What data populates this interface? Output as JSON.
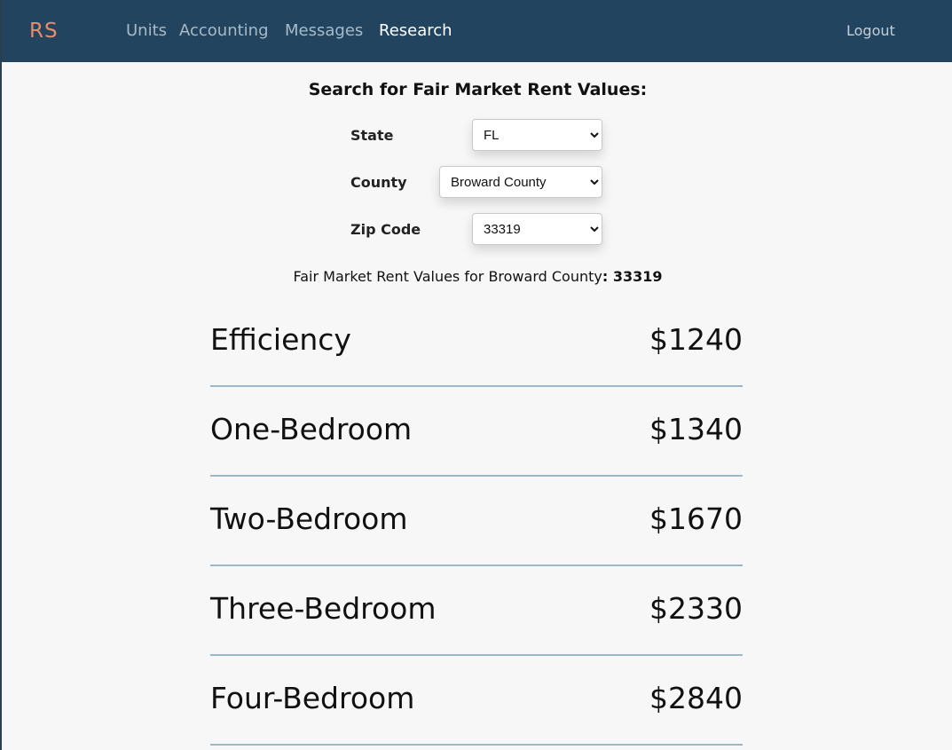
{
  "navbar": {
    "brand": "RS",
    "links": [
      {
        "label": "Units",
        "active": false
      },
      {
        "label": "Accounting",
        "active": false
      },
      {
        "label": "Messages",
        "active": false
      },
      {
        "label": "Research",
        "active": true
      }
    ],
    "logout": "Logout"
  },
  "search": {
    "title": "Search for Fair Market Rent Values:",
    "state": {
      "label": "State",
      "value": "FL"
    },
    "county": {
      "label": "County",
      "value": "Broward County"
    },
    "zip": {
      "label": "Zip Code",
      "value": "33319"
    }
  },
  "result": {
    "prefix": "Fair Market Rent Values for Broward County",
    "separator": ": ",
    "zip": "33319"
  },
  "rents": [
    {
      "type": "Efficiency",
      "value": "$1240"
    },
    {
      "type": "One-Bedroom",
      "value": "$1340"
    },
    {
      "type": "Two-Bedroom",
      "value": "$1670"
    },
    {
      "type": "Three-Bedroom",
      "value": "$2330"
    },
    {
      "type": "Four-Bedroom",
      "value": "$2840"
    }
  ],
  "colors": {
    "navbar": "#23445f",
    "brand": "#e98a6c",
    "divider": "#9db7c6",
    "background": "#f7f7f7"
  }
}
